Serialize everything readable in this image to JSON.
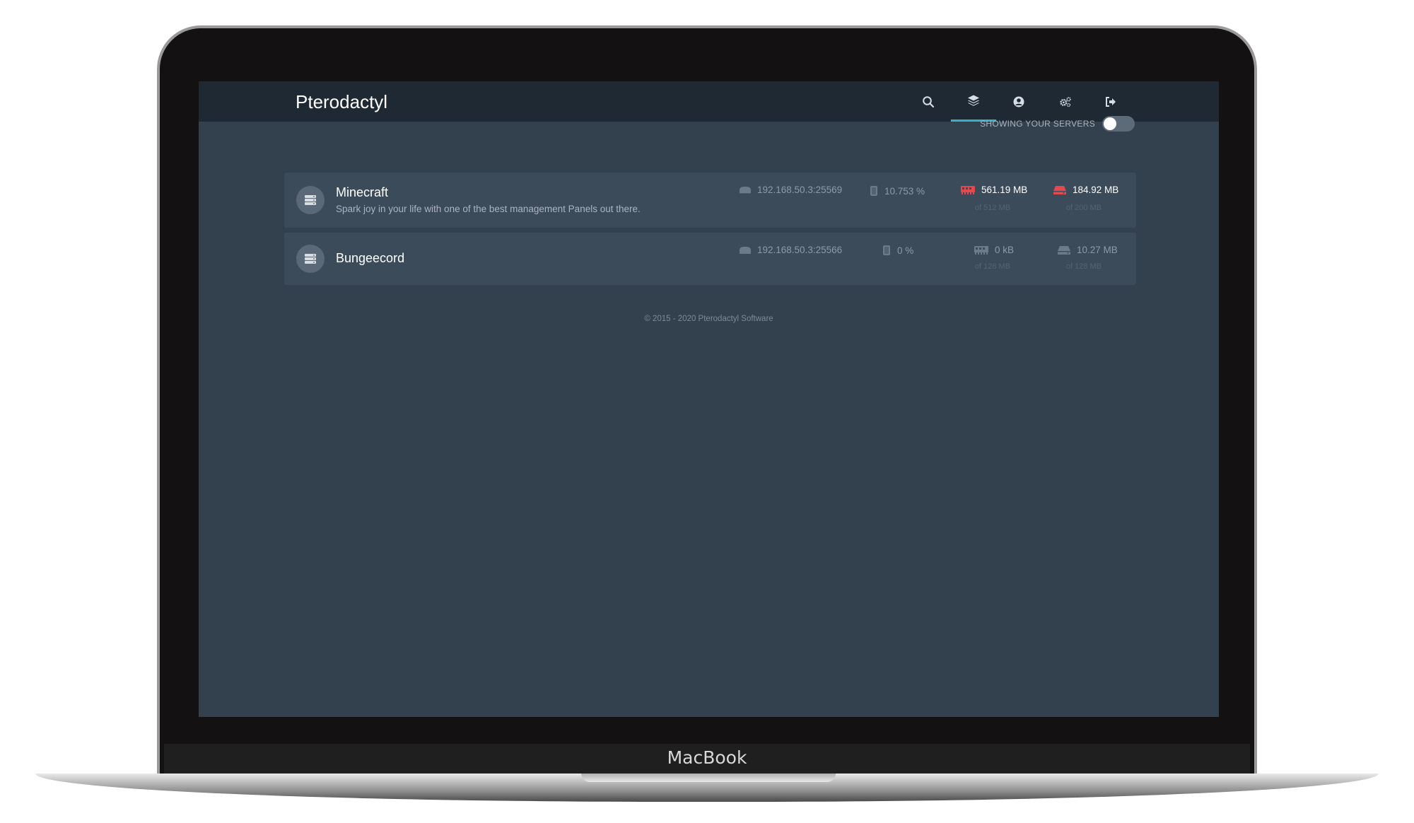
{
  "device": {
    "brand": "MacBook"
  },
  "app": {
    "title": "Pterodactyl"
  },
  "nav": [
    {
      "icon": "search-icon",
      "active": false
    },
    {
      "icon": "layers-icon",
      "active": true
    },
    {
      "icon": "user-circle-icon",
      "active": false
    },
    {
      "icon": "cogs-icon",
      "active": false
    },
    {
      "icon": "sign-out-icon",
      "active": false
    }
  ],
  "toggle": {
    "label": "SHOWING YOUR SERVERS",
    "on": false
  },
  "servers": [
    {
      "name": "Minecraft",
      "description": "Spark joy in your life with one of the best management Panels out there.",
      "allocation": "192.168.50.3:25569",
      "cpu": "10.753 %",
      "memory": {
        "used": "561.19 MB",
        "limit": "of 512 MB",
        "alert": true
      },
      "disk": {
        "used": "184.92 MB",
        "limit": "of 200 MB",
        "alert": true
      }
    },
    {
      "name": "Bungeecord",
      "description": "",
      "allocation": "192.168.50.3:25566",
      "cpu": "0 %",
      "memory": {
        "used": "0 kB",
        "limit": "of 128 MB",
        "alert": false
      },
      "disk": {
        "used": "10.27 MB",
        "limit": "of 128 MB",
        "alert": false
      }
    }
  ],
  "footer": {
    "text": "© 2015 - 2020 Pterodactyl Software"
  },
  "colors": {
    "alert": "#e5484d",
    "accent": "#38b2c6",
    "background": "#33404d",
    "topbar": "#1f2933"
  }
}
